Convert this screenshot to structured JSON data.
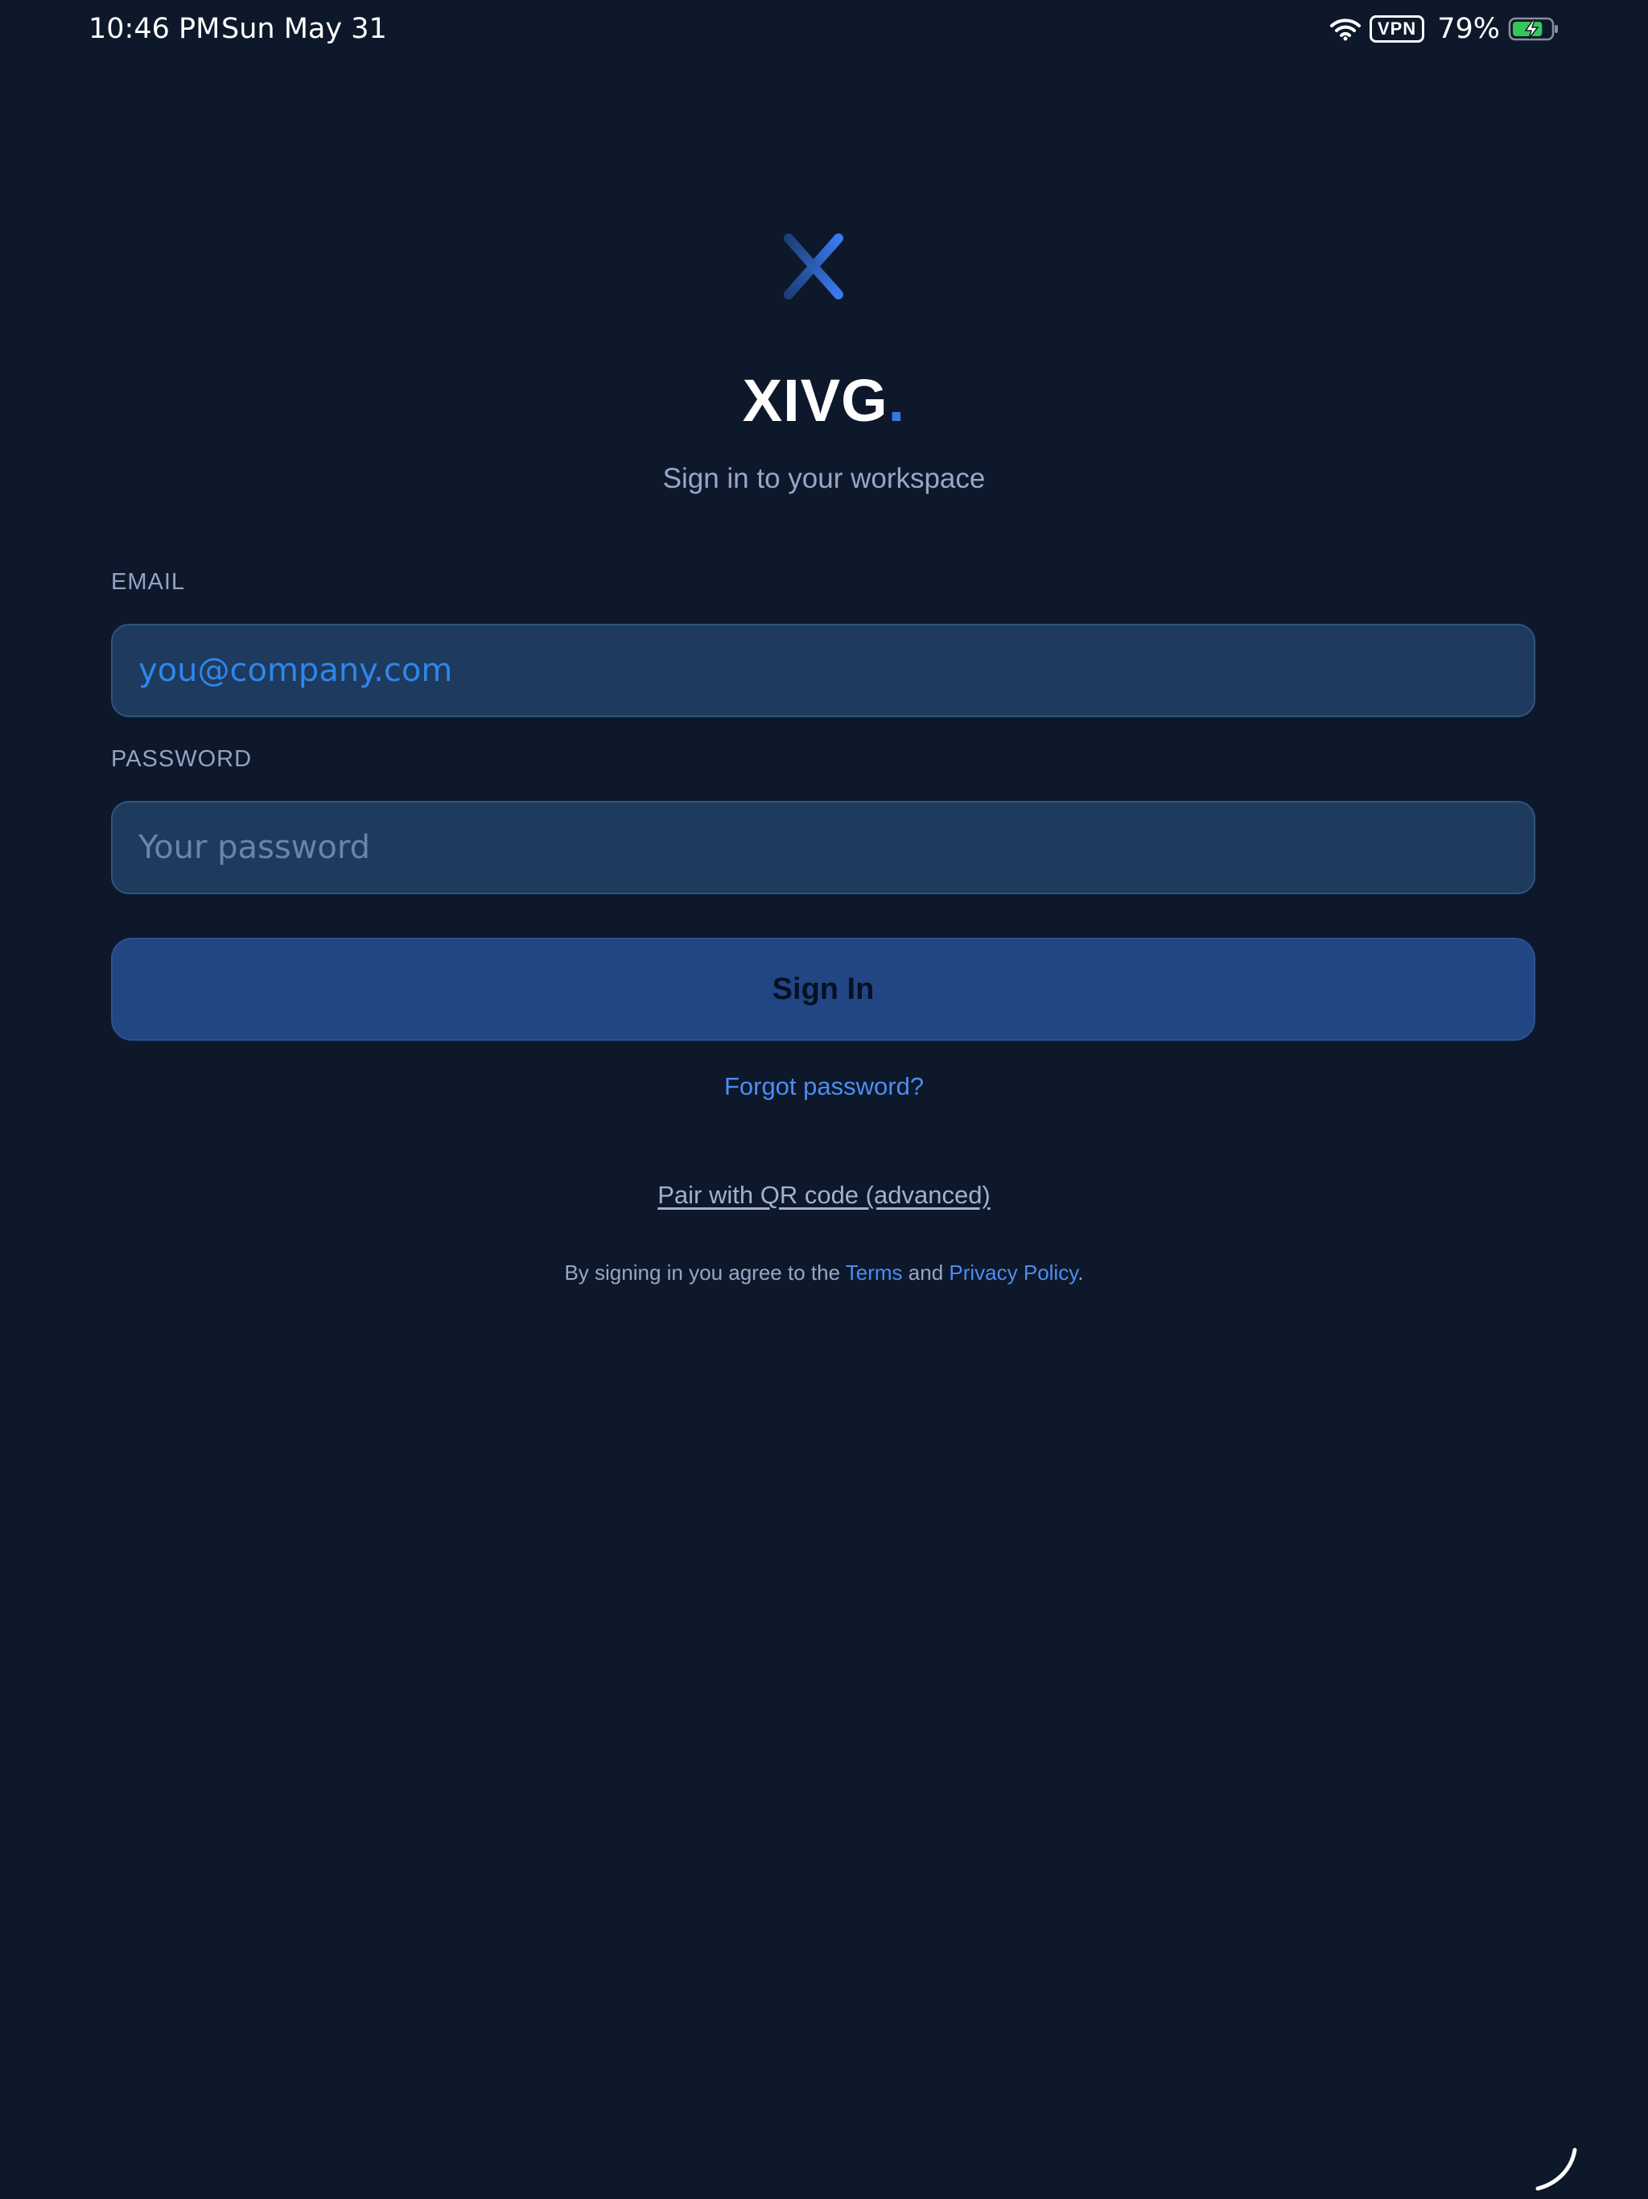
{
  "status_bar": {
    "time": "10:46 PM",
    "date": "Sun May 31",
    "vpn_label": "VPN",
    "battery_percent": "79%",
    "battery_level": 0.79,
    "icons": [
      "wifi-icon",
      "battery-charging-icon"
    ]
  },
  "brand": {
    "name": "XIVG",
    "dot": ".",
    "subtitle": "Sign in to your workspace",
    "accent_color": "#3b78e7"
  },
  "form": {
    "email_label": "EMAIL",
    "email_placeholder": "you@company.com",
    "password_label": "PASSWORD",
    "password_placeholder": "Your password",
    "submit_label": "Sign In"
  },
  "links": {
    "forgot_password": "Forgot password?",
    "qr_pair": "Pair with QR code (advanced)"
  },
  "legal": {
    "prefix": "By signing in you agree to the ",
    "terms": "Terms",
    "and": " and ",
    "privacy": "Privacy Policy",
    "suffix": "."
  },
  "colors": {
    "background": "#0e182b",
    "input_bg": "#1e3a5e",
    "button_bg": "#224683",
    "link": "#4c8df0"
  }
}
